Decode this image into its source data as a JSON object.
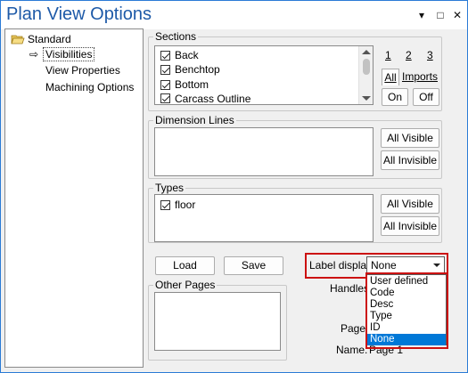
{
  "window": {
    "title": "Plan View Options",
    "controls": {
      "dropdown": "▾",
      "maximize": "□",
      "close": "✕"
    }
  },
  "tree": {
    "root": "Standard",
    "items": [
      {
        "label": "Visibilities",
        "selected": true
      },
      {
        "label": "View Properties"
      },
      {
        "label": "Machining Options"
      }
    ]
  },
  "sections": {
    "title": "Sections",
    "items": [
      "Back",
      "Benchtop",
      "Bottom",
      "Carcass Outline"
    ],
    "num_tabs": [
      "1",
      "2",
      "3"
    ],
    "tabs": [
      "All",
      "Imports"
    ],
    "on_label": "On",
    "off_label": "Off"
  },
  "dimension_lines": {
    "title": "Dimension Lines",
    "all_visible": "All Visible",
    "all_invisible": "All Invisible"
  },
  "types": {
    "title": "Types",
    "items": [
      "floor"
    ],
    "all_visible": "All Visible",
    "all_invisible": "All Invisible"
  },
  "buttons": {
    "load": "Load",
    "save": "Save"
  },
  "other_pages": {
    "title": "Other Pages"
  },
  "label_display": {
    "label": "Label display:",
    "value": "None",
    "options": [
      "User defined",
      "Code",
      "Desc",
      "Type",
      "ID",
      "None"
    ],
    "selected_index": 5
  },
  "fields": {
    "handles_label": "Handles:",
    "page_label": "Page",
    "name_label": "Name:",
    "name_value": "Page 1"
  },
  "colors": {
    "title_text": "#1e5aa8",
    "highlight_border": "#cc1111",
    "selection": "#0078d7"
  }
}
